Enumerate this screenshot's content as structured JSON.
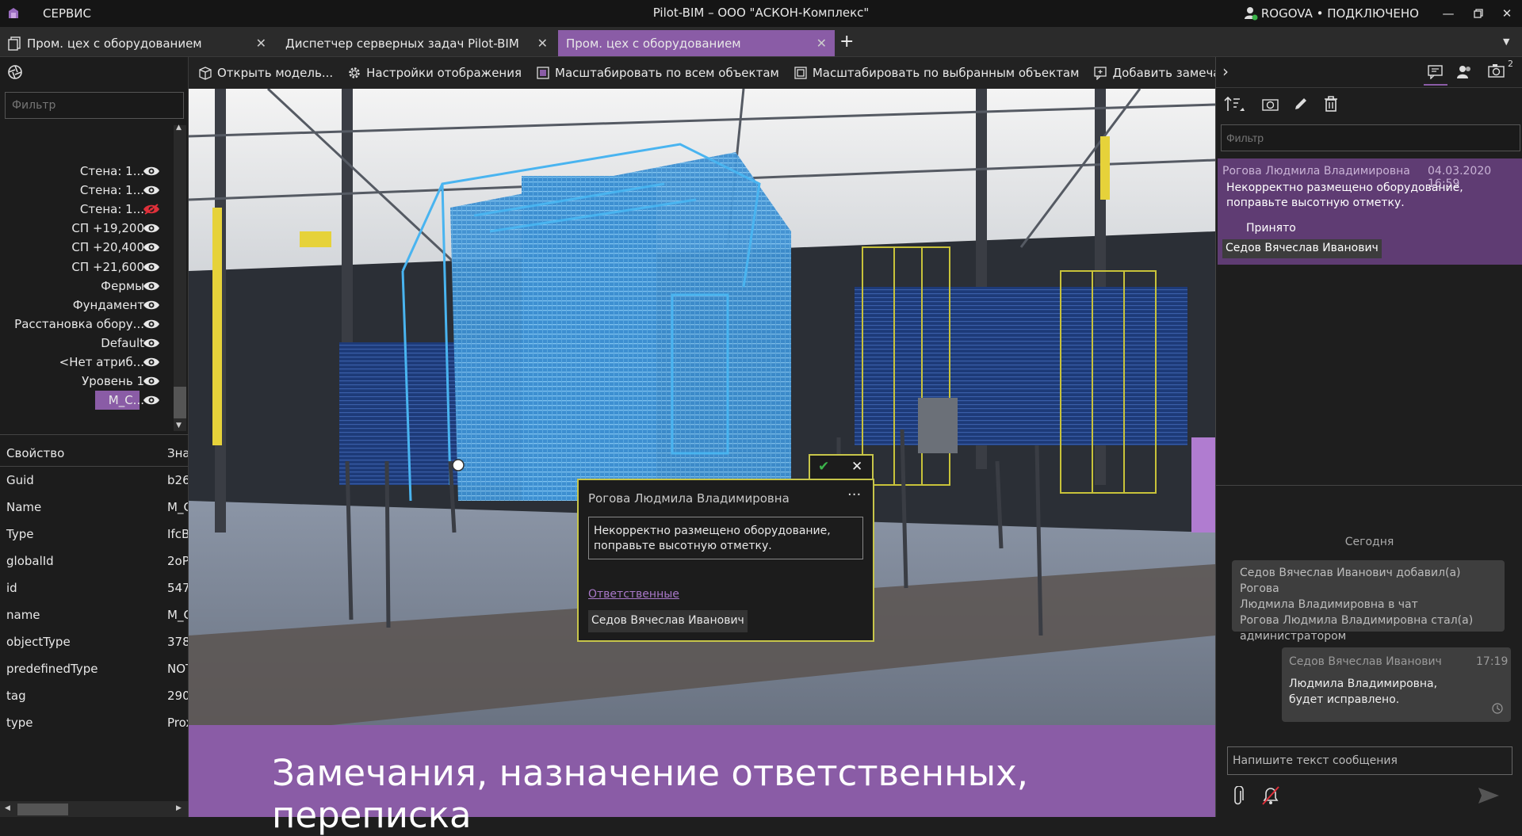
{
  "titlebar": {
    "menu": "СЕРВИС",
    "title": "Pilot-BIM – ООО \"АСКОН-Комплекс\"",
    "user": "ROGOVA • ПОДКЛЮЧЕНО"
  },
  "tabs": [
    {
      "label": "Пром. цех с оборудованием"
    },
    {
      "label": "Диспетчер серверных задач Pilot-BIM"
    },
    {
      "label": "Пром. цех с оборудованием"
    }
  ],
  "left": {
    "filter_placeholder": "Фильтр",
    "layers": [
      {
        "label": "Стена: 1...",
        "visible": true
      },
      {
        "label": "Стена: 1...",
        "visible": true
      },
      {
        "label": "Стена: 1...",
        "visible": false
      },
      {
        "label": "СП +19,200",
        "visible": true
      },
      {
        "label": "СП +20,400",
        "visible": true
      },
      {
        "label": "СП +21,600",
        "visible": true
      },
      {
        "label": "Фермы",
        "visible": true
      },
      {
        "label": "Фундамент",
        "visible": true
      },
      {
        "label": "Расстановка обору...",
        "visible": true
      },
      {
        "label": "Default",
        "visible": true
      },
      {
        "label": "<Нет атриб...",
        "visible": true
      },
      {
        "label": "Уровень 1",
        "visible": true
      },
      {
        "label": "M_C...",
        "visible": true
      }
    ],
    "props_header": {
      "key": "Свойство",
      "value": "Знач"
    },
    "props": [
      {
        "key": "Guid",
        "value": "b26"
      },
      {
        "key": "Name",
        "value": "M_C"
      },
      {
        "key": "Type",
        "value": "IfcB"
      },
      {
        "key": "globalId",
        "value": "2oP"
      },
      {
        "key": "id",
        "value": "547"
      },
      {
        "key": "name",
        "value": "M_C"
      },
      {
        "key": "objectType",
        "value": "378"
      },
      {
        "key": "predefinedType",
        "value": "NOT"
      },
      {
        "key": "tag",
        "value": "290"
      },
      {
        "key": "type",
        "value": "Prox"
      }
    ]
  },
  "toolbar": {
    "open_model": "Открыть модель...",
    "display_settings": "Настройки отображения",
    "zoom_all": "Масштабировать по всем объектам",
    "zoom_selected": "Масштабировать по выбранным объектам",
    "add_remark": "Добавить замечание"
  },
  "popup": {
    "author": "Рогова Людмила Владимировна",
    "menu": "···",
    "text1": "Некорректно размещено оборудование,",
    "text2": "поправьте высотную отметку.",
    "responsible_link": "Ответственные",
    "responsible": "Седов Вячеслав Иванович"
  },
  "banner": {
    "text": "Замечания, назначение ответственных, переписка"
  },
  "right": {
    "camera_badge": "2",
    "filter_placeholder": "Фильтр",
    "remark": {
      "author": "Рогова Людмила Владимировна",
      "date": "04.03.2020 16:59",
      "text1": "Некорректно размещено оборудование,",
      "text2": "поправьте высотную отметку.",
      "status": "Принято",
      "responsible": "Седов Вячеслав Иванович"
    },
    "chat": {
      "day": "Сегодня",
      "system1": "Седов Вячеслав Иванович добавил(а) Рогова",
      "system2": "Людмила Владимировна в чат",
      "system3": "Рогова Людмила Владимировна стал(а)",
      "system4": "администратором",
      "msg_author": "Седов Вячеслав Иванович",
      "msg_time": "17:19",
      "msg_text1": "Людмила Владимировна,",
      "msg_text2": "будет исправлено.",
      "input_placeholder": "Напишите текст сообщения"
    }
  },
  "colors": {
    "accent": "#8a5ca6",
    "remark_bg": "#5f3c73",
    "popup_border": "#c7c54a",
    "eye_off": "#e0303a"
  }
}
